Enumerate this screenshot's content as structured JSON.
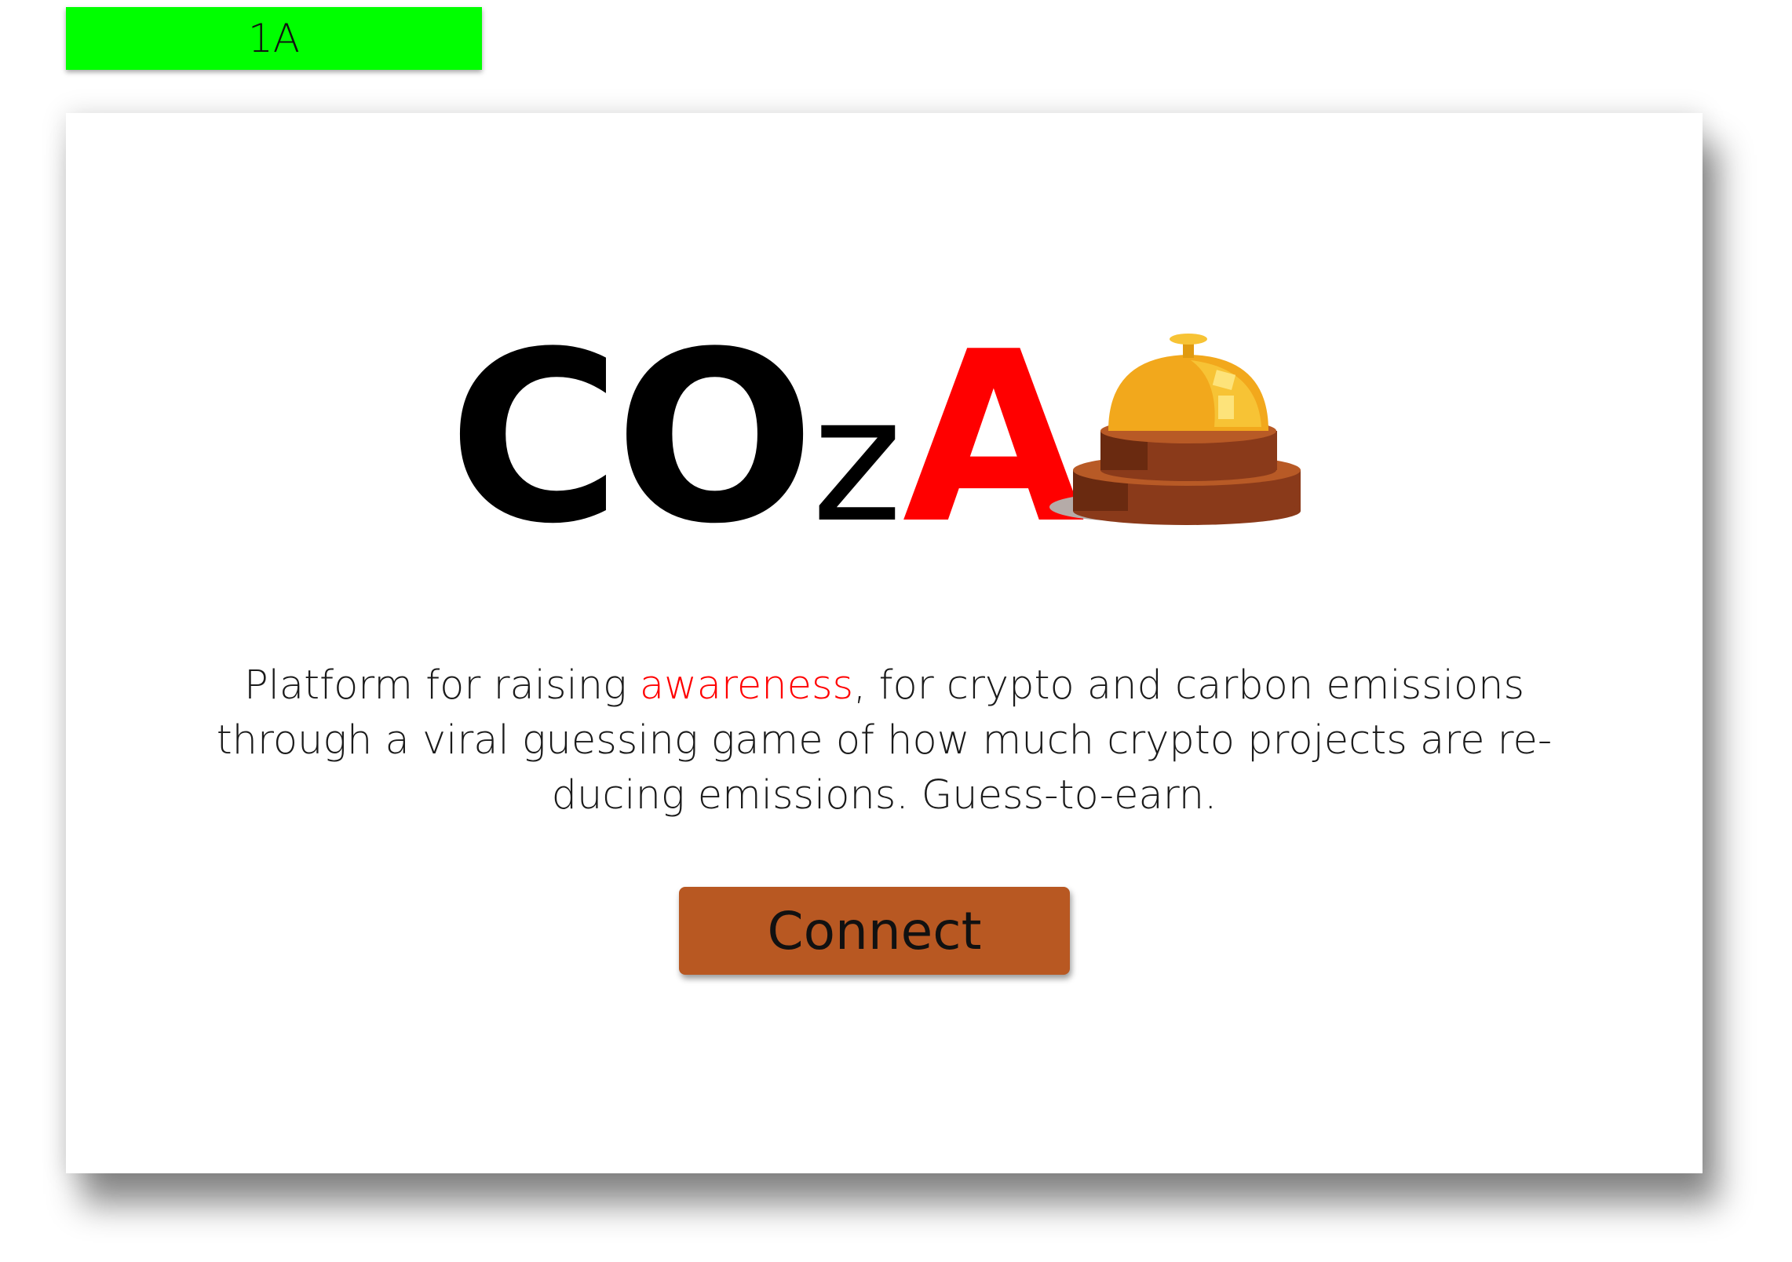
{
  "screen_tag": {
    "label": "1A",
    "color": "#00ff00"
  },
  "logo": {
    "part1": "CO",
    "part2": "z",
    "part3": "A",
    "accent_color": "#ff0000",
    "icon": "service-bell-icon"
  },
  "tagline": {
    "before": "Platform for raising ",
    "highlight": "awareness",
    "after": ", for crypto and carbon emissions through a viral guessing game of how much crypto projects are re-ducing emissions. Guess-to-earn."
  },
  "connect_button": {
    "label": "Connect",
    "color": "#b85822"
  }
}
